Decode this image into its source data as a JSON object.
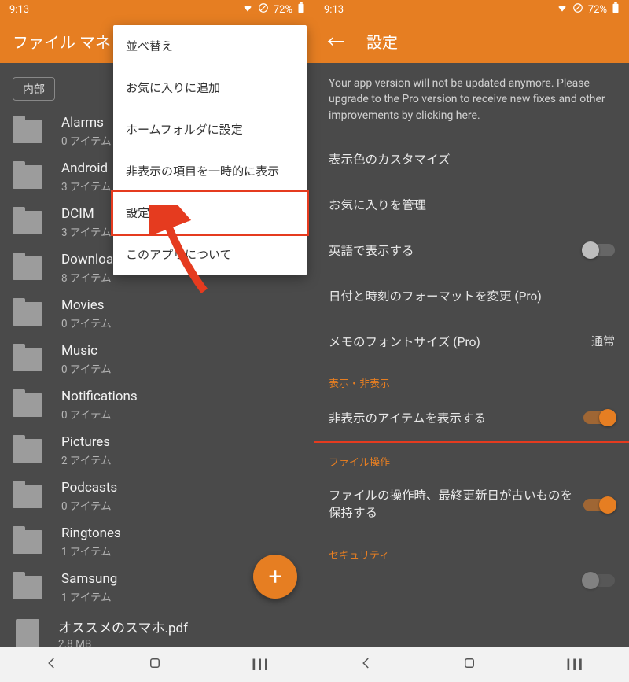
{
  "status": {
    "time": "9:13",
    "battery": "72%"
  },
  "left": {
    "title": "ファイル マネ",
    "chip": "内部",
    "folders": [
      {
        "name": "Alarms",
        "sub": "0 アイテム"
      },
      {
        "name": "Android",
        "sub": "3 アイテム"
      },
      {
        "name": "DCIM",
        "sub": "3 アイテム"
      },
      {
        "name": "Download",
        "sub": "8 アイテム"
      },
      {
        "name": "Movies",
        "sub": "0 アイテム"
      },
      {
        "name": "Music",
        "sub": "0 アイテム"
      },
      {
        "name": "Notifications",
        "sub": "0 アイテム"
      },
      {
        "name": "Pictures",
        "sub": "2 アイテム"
      },
      {
        "name": "Podcasts",
        "sub": "0 アイテム"
      },
      {
        "name": "Ringtones",
        "sub": "1 アイテム"
      },
      {
        "name": "Samsung",
        "sub": "1 アイテム"
      }
    ],
    "file": {
      "name": "オススメのスマホ.pdf",
      "sub": "2.8 MB"
    },
    "menu": [
      "並べ替え",
      "お気に入りに追加",
      "ホームフォルダに設定",
      "非表示の項目を一時的に表示",
      "設定",
      "このアプリについて"
    ],
    "fab": "+"
  },
  "right": {
    "title": "設定",
    "notice": "Your app version will not be updated anymore. Please upgrade to the Pro version to receive new fixes and other improvements by clicking here.",
    "rows": {
      "customize": "表示色のカスタマイズ",
      "favorites": "お気に入りを管理",
      "english": "英語で表示する",
      "dateformat": "日付と時刻のフォーマットを変更 (Pro)",
      "fontsize": "メモのフォントサイズ (Pro)",
      "fontsize_val": "通常",
      "sec_visibility": "表示・非表示",
      "show_hidden": "非表示のアイテムを表示する",
      "sec_fileop": "ファイル操作",
      "keep_old": "ファイルの操作時、最終更新日が古いものを保持する",
      "sec_security": "セキュリティ"
    }
  }
}
